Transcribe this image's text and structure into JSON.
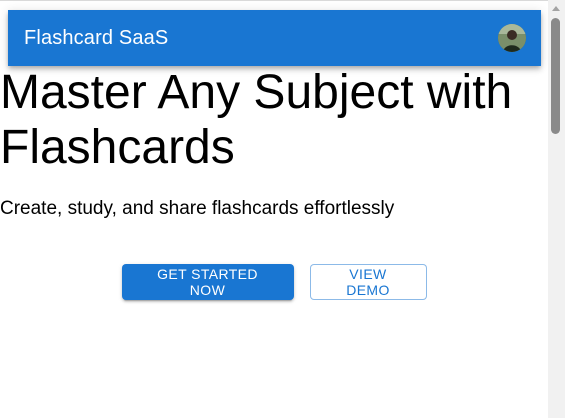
{
  "appbar": {
    "title": "Flashcard SaaS",
    "avatar_icon": "user-avatar",
    "color": "#1976d2"
  },
  "hero": {
    "title": "Master Any Subject with Flashcards",
    "subtitle": "Create, study, and share flashcards effortlessly"
  },
  "actions": {
    "primary_label": "GET STARTED NOW",
    "secondary_label": "VIEW DEMO"
  }
}
